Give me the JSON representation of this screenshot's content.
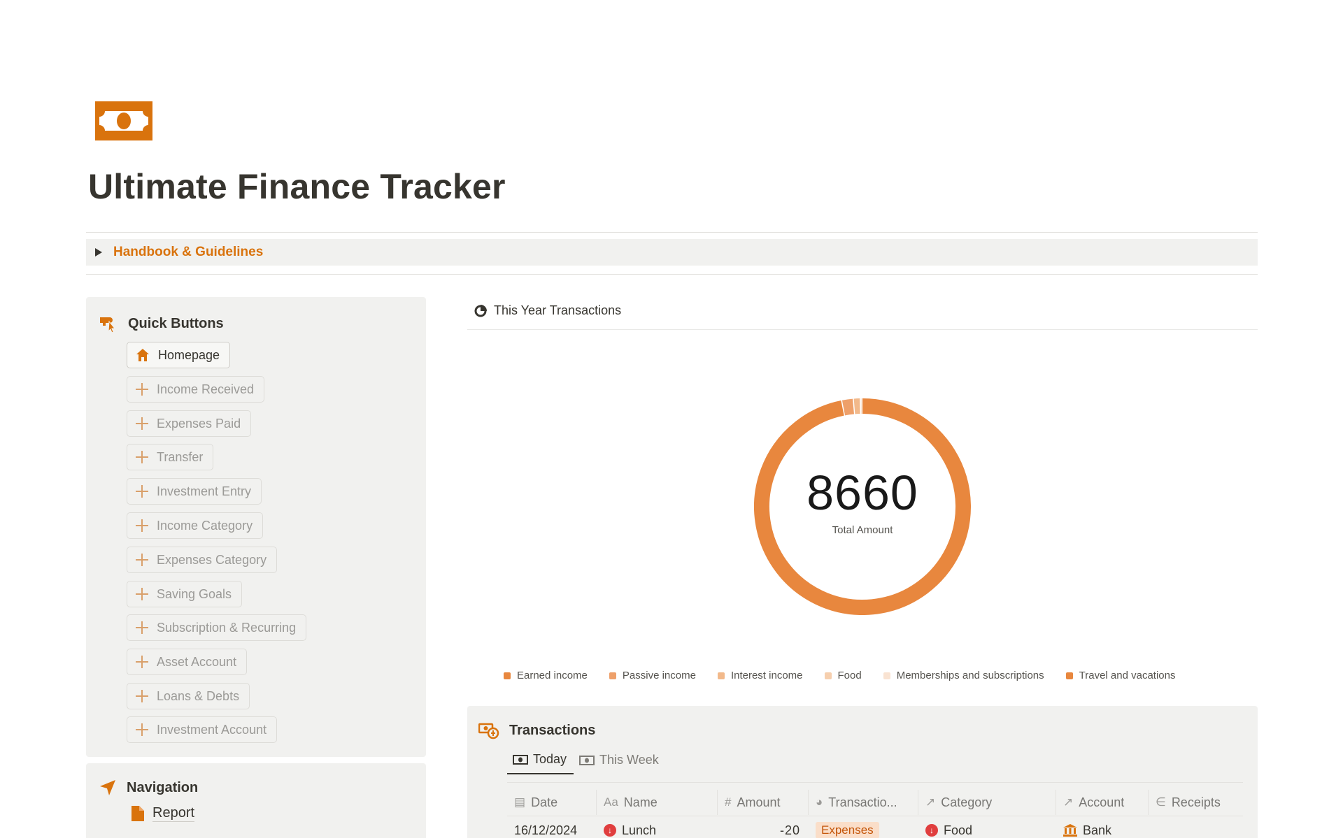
{
  "page": {
    "title": "Ultimate Finance Tracker",
    "icon": "banknote-icon",
    "accent_color": "#d9730d"
  },
  "toggle": {
    "label": "Handbook & Guidelines"
  },
  "quick_buttons": {
    "title": "Quick Buttons",
    "icon": "hand-pointer-icon",
    "items": [
      {
        "label": "Homepage",
        "icon": "home-icon"
      },
      {
        "label": "Income Received",
        "icon": "plus-icon"
      },
      {
        "label": "Expenses Paid",
        "icon": "plus-icon"
      },
      {
        "label": "Transfer",
        "icon": "plus-icon"
      },
      {
        "label": "Investment Entry",
        "icon": "plus-icon"
      },
      {
        "label": "Income Category",
        "icon": "plus-icon"
      },
      {
        "label": "Expenses Category",
        "icon": "plus-icon"
      },
      {
        "label": "Saving Goals",
        "icon": "plus-icon"
      },
      {
        "label": "Subscription & Recurring",
        "icon": "plus-icon"
      },
      {
        "label": "Asset Account",
        "icon": "plus-icon"
      },
      {
        "label": "Loans & Debts",
        "icon": "plus-icon"
      },
      {
        "label": "Investment Account",
        "icon": "plus-icon"
      }
    ]
  },
  "navigation": {
    "title": "Navigation",
    "icon": "location-arrow-icon",
    "items": [
      {
        "label": "Report",
        "icon": "document-icon"
      }
    ]
  },
  "chart": {
    "header": "This Year Transactions",
    "header_icon": "pie-chart-icon",
    "total_value": "8660",
    "total_label": "Total Amount",
    "legend": [
      {
        "label": "Earned income",
        "color": "#e8873e"
      },
      {
        "label": "Passive income",
        "color": "#eea06a"
      },
      {
        "label": "Interest income",
        "color": "#f2b98b"
      },
      {
        "label": "Food",
        "color": "#f6cfae"
      },
      {
        "label": "Memberships and subscriptions",
        "color": "#f9e3d2"
      },
      {
        "label": "Travel and vacations",
        "color": "#e8873e"
      }
    ]
  },
  "chart_data": {
    "type": "pie",
    "title": "This Year Transactions",
    "categories": [
      "Earned income",
      "Passive income",
      "Interest income",
      "Food"
    ],
    "values": [
      8400,
      150,
      90,
      20
    ],
    "total": 8660,
    "legend_position": "bottom"
  },
  "transactions": {
    "title": "Transactions",
    "icon": "money-cycle-icon",
    "tabs": [
      {
        "label": "Today",
        "icon": "banknote-icon"
      },
      {
        "label": "This Week",
        "icon": "banknote-icon"
      }
    ],
    "columns": [
      {
        "label": "Date",
        "icon": "calendar-icon"
      },
      {
        "label": "Name",
        "icon": "text-icon"
      },
      {
        "label": "Amount",
        "icon": "hash-icon"
      },
      {
        "label": "Transactio...",
        "icon": "chevron-circle-icon"
      },
      {
        "label": "Category",
        "icon": "relation-arrow-icon"
      },
      {
        "label": "Account",
        "icon": "relation-arrow-icon"
      },
      {
        "label": "Receipts",
        "icon": "paperclip-icon"
      }
    ],
    "rows": [
      {
        "date": "16/12/2024",
        "name": "Lunch",
        "amount": "-20",
        "type": "Expenses",
        "category": "Food",
        "account": "Bank"
      }
    ]
  }
}
